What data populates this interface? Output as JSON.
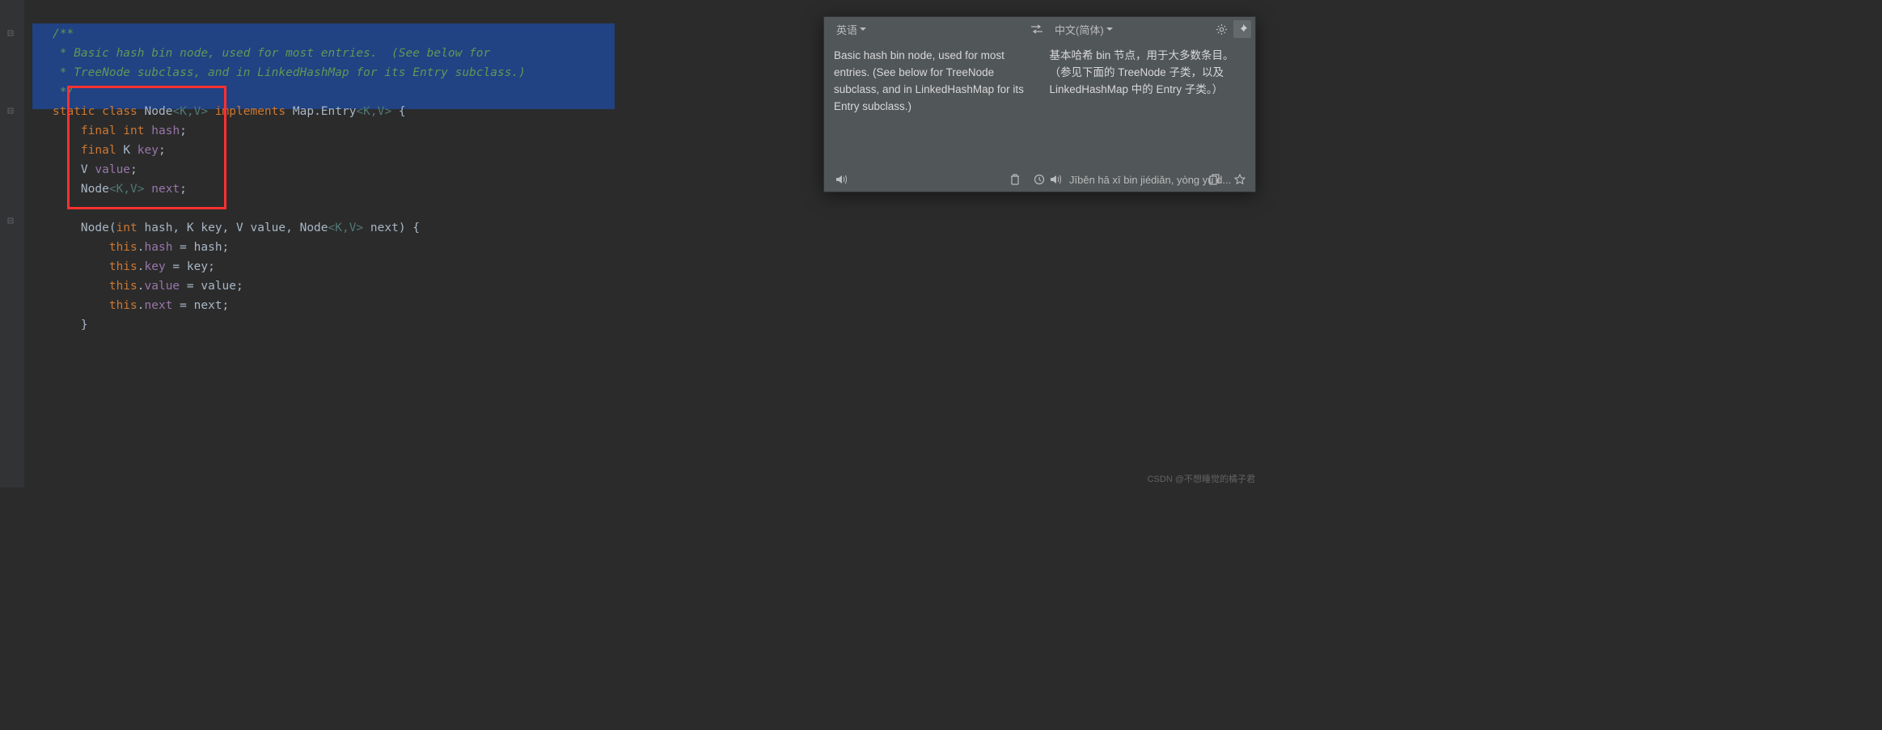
{
  "code": {
    "comment1": "/**",
    "comment2": " * Basic hash bin node, used for most entries.  (See below for",
    "comment3": " * TreeNode subclass, and in LinkedHashMap for its Entry subclass.)",
    "comment4": " */",
    "static": "static",
    "class": "class",
    "node": "Node",
    "kv1": "<K,V>",
    "implements": "implements",
    "mapentry": "Map.Entry",
    "kv2": "<K,V>",
    "brace_open": " {",
    "final1": "final",
    "int": "int",
    "hash_field": "hash",
    "semi": ";",
    "final2": "final",
    "k": "K",
    "key_field": "key",
    "v": "V",
    "value_field": "value",
    "nodekv": "Node<K,V>",
    "next_field": "next",
    "ctor_name": "Node",
    "ctor_params": "(int hash, K key, V value, Node<K,V> next) {",
    "this1": "this",
    "dot": ".",
    "eq": " = ",
    "hash_var": "hash",
    "key_var": "key",
    "value_var": "value",
    "next_var": "next",
    "brace_close": "}"
  },
  "translate": {
    "source_lang": "英语",
    "target_lang": "中文(简体)",
    "source_text": "Basic hash bin node, used for most entries. (See below for TreeNode subclass, and in LinkedHashMap for its Entry subclass.)",
    "target_text": "基本哈希 bin 节点，用于大多数条目。 （参见下面的 TreeNode 子类，以及 LinkedHashMap 中的 Entry 子类。）",
    "pinyin": "Jīběn hā xī bin jiédiǎn, yòng yú d..."
  },
  "watermark": "CSDN @不想睡觉的橘子君"
}
